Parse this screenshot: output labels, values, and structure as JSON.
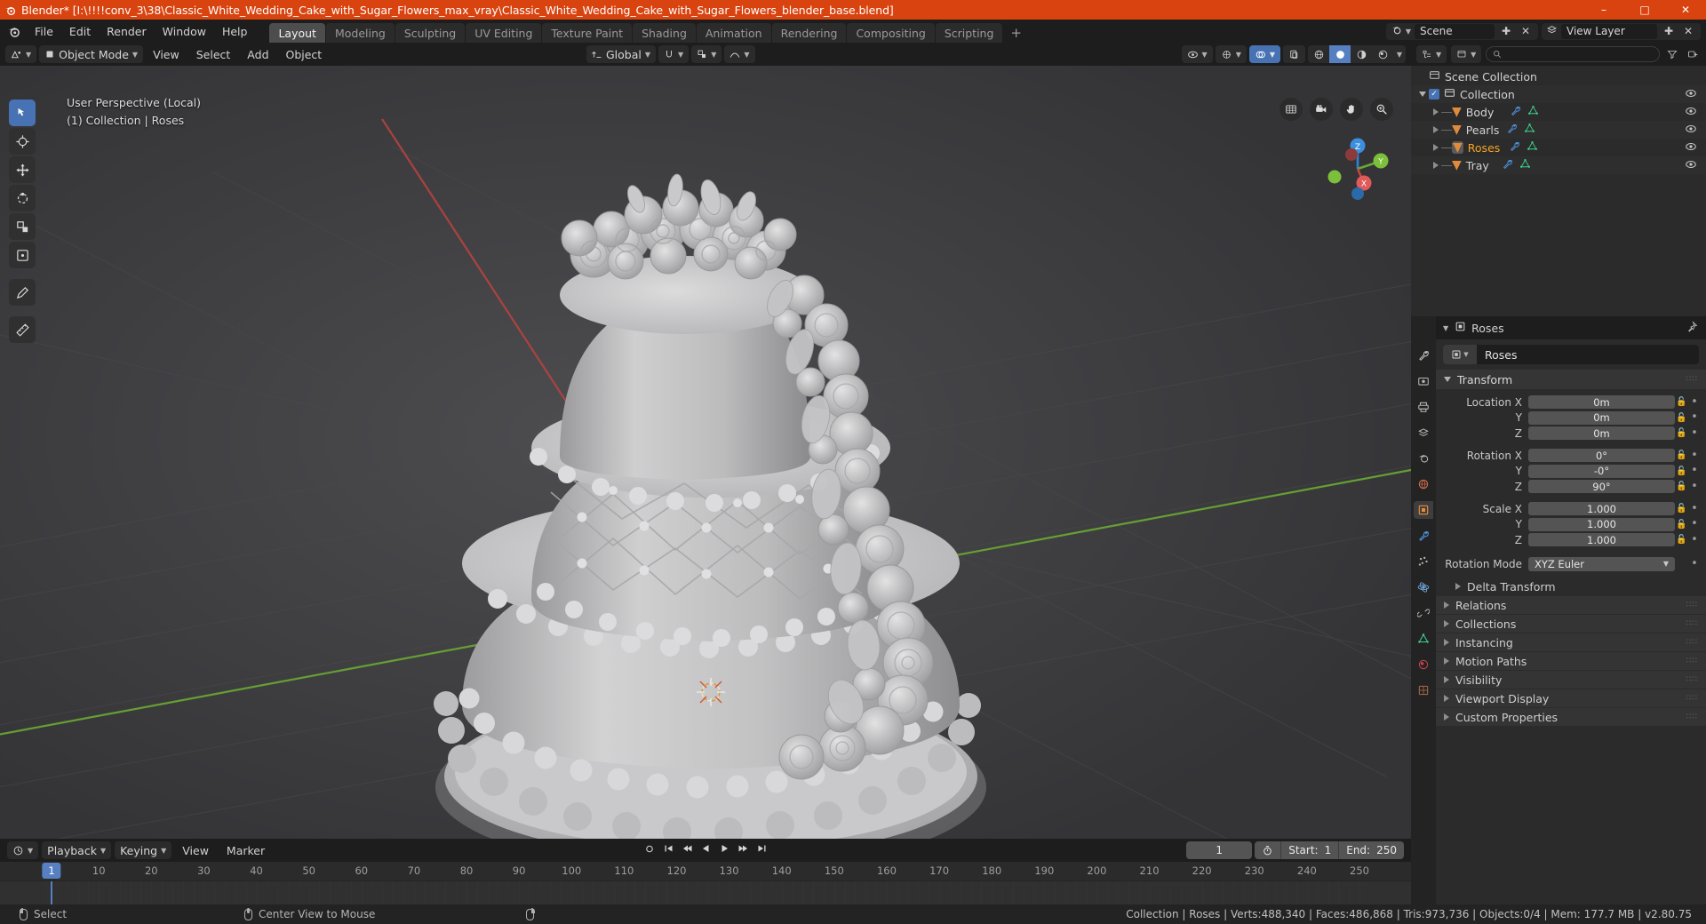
{
  "titlebar": {
    "text": "Blender* [I:\\!!!!conv_3\\38\\Classic_White_Wedding_Cake_with_Sugar_Flowers_max_vray\\Classic_White_Wedding_Cake_with_Sugar_Flowers_blender_base.blend]",
    "minimize": "–",
    "maximize": "□",
    "close": "✕",
    "bg_color": "#d9430f"
  },
  "topbar": {
    "menus": [
      "File",
      "Edit",
      "Render",
      "Window",
      "Help"
    ],
    "workspaces": [
      {
        "label": "Layout",
        "active": true
      },
      {
        "label": "Modeling",
        "active": false
      },
      {
        "label": "Sculpting",
        "active": false
      },
      {
        "label": "UV Editing",
        "active": false
      },
      {
        "label": "Texture Paint",
        "active": false
      },
      {
        "label": "Shading",
        "active": false
      },
      {
        "label": "Animation",
        "active": false
      },
      {
        "label": "Rendering",
        "active": false
      },
      {
        "label": "Compositing",
        "active": false
      },
      {
        "label": "Scripting",
        "active": false
      }
    ],
    "add_workspace": "+",
    "scene_label": "Scene",
    "viewlayer_label": "View Layer"
  },
  "viewport": {
    "mode": "Object Mode",
    "menus": [
      "View",
      "Select",
      "Add",
      "Object"
    ],
    "transform_orientation": "Global",
    "overlay_line1": "User Perspective (Local)",
    "overlay_line2": "(1) Collection | Roses",
    "gizmo_axes": {
      "z": "Z",
      "y": "Y",
      "x": "X"
    },
    "nav_icons": [
      "grid-icon",
      "camera-icon",
      "hand-icon",
      "zoom-icon"
    ],
    "tools": [
      {
        "name": "select-box-tool",
        "glyph": "⬚",
        "active": true
      },
      {
        "name": "cursor-tool",
        "glyph": "⊕",
        "active": false
      },
      {
        "name": "move-tool",
        "glyph": "✛",
        "active": false
      },
      {
        "name": "rotate-tool",
        "glyph": "↺",
        "active": false
      },
      {
        "name": "scale-tool",
        "glyph": "⤡",
        "active": false
      },
      {
        "name": "transform-tool",
        "glyph": "⬜",
        "active": false
      },
      {
        "name": "annotate-tool",
        "glyph": "✎",
        "active": false
      },
      {
        "name": "measure-tool",
        "glyph": "◱",
        "active": false
      }
    ]
  },
  "outliner": {
    "root": "Scene Collection",
    "collection": "Collection",
    "items": [
      {
        "label": "Body",
        "selected": false
      },
      {
        "label": "Pearls",
        "selected": false
      },
      {
        "label": "Roses",
        "selected": true
      },
      {
        "label": "Tray",
        "selected": false
      }
    ],
    "search_placeholder": ""
  },
  "properties": {
    "breadcrumb_object": "Roses",
    "name_value": "Roses",
    "panel_title": "Transform",
    "transform_rows": [
      {
        "label": "Location X",
        "value": "0m"
      },
      {
        "label": "Y",
        "value": "0m"
      },
      {
        "label": "Z",
        "value": "0m"
      },
      {
        "label": "Rotation X",
        "value": "0°"
      },
      {
        "label": "Y",
        "value": "-0°"
      },
      {
        "label": "Z",
        "value": "90°"
      },
      {
        "label": "Scale X",
        "value": "1.000"
      },
      {
        "label": "Y",
        "value": "1.000"
      },
      {
        "label": "Z",
        "value": "1.000"
      }
    ],
    "rotation_mode_label": "Rotation Mode",
    "rotation_mode_value": "XYZ Euler",
    "delta_transform": "Delta Transform",
    "collapsed_panels": [
      "Relations",
      "Collections",
      "Instancing",
      "Motion Paths",
      "Visibility",
      "Viewport Display",
      "Custom Properties"
    ]
  },
  "timeline": {
    "menus": [
      "Playback",
      "Keying",
      "View",
      "Marker"
    ],
    "current_frame": "1",
    "start_label": "Start:",
    "start_value": "1",
    "end_label": "End:",
    "end_value": "250",
    "ticks": [
      "10",
      "20",
      "30",
      "40",
      "50",
      "60",
      "70",
      "80",
      "90",
      "100",
      "110",
      "120",
      "130",
      "140",
      "150",
      "160",
      "170",
      "180",
      "190",
      "200",
      "210",
      "220",
      "230",
      "240",
      "250"
    ],
    "playhead_label": "1"
  },
  "statusbar": {
    "hints": [
      {
        "icon": "mouse-left-icon",
        "label": "Select"
      },
      {
        "icon": "mouse-middle-icon",
        "label": "Center View to Mouse"
      },
      {
        "icon": "mouse-right-icon",
        "label": ""
      }
    ],
    "stats": "Collection | Roses | Verts:488,340 | Faces:486,868 | Tris:973,736 | Objects:0/4 | Mem: 177.7 MB | v2.80.75"
  }
}
